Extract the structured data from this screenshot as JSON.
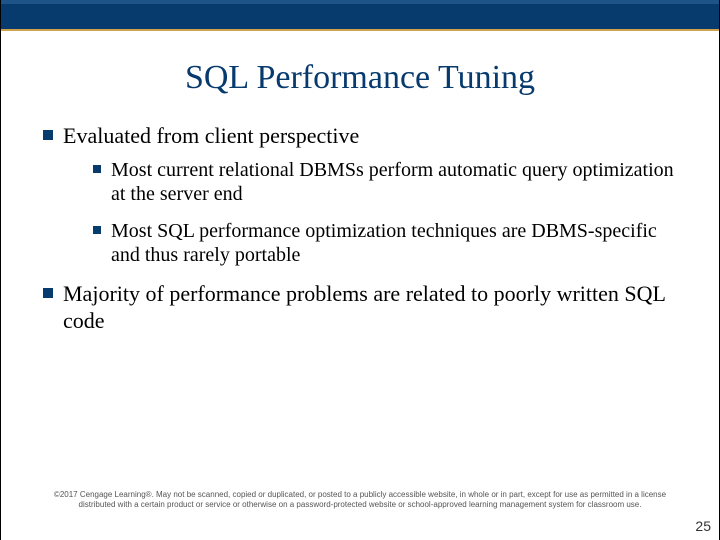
{
  "title": "SQL Performance Tuning",
  "bullets": {
    "b1": "Evaluated from client perspective",
    "b1_1": "Most current relational DBMSs perform automatic query optimization at the server end",
    "b1_2": "Most SQL performance optimization techniques are DBMS-specific and thus rarely portable",
    "b2": "Majority of performance problems are related to poorly written SQL code"
  },
  "footer": "©2017 Cengage Learning®. May not be scanned, copied or duplicated, or posted to a publicly accessible website, in whole or in part, except for use as permitted in a license distributed with a certain product or service or otherwise on a password-protected website or school-approved learning management system for classroom use.",
  "page_number": "25"
}
